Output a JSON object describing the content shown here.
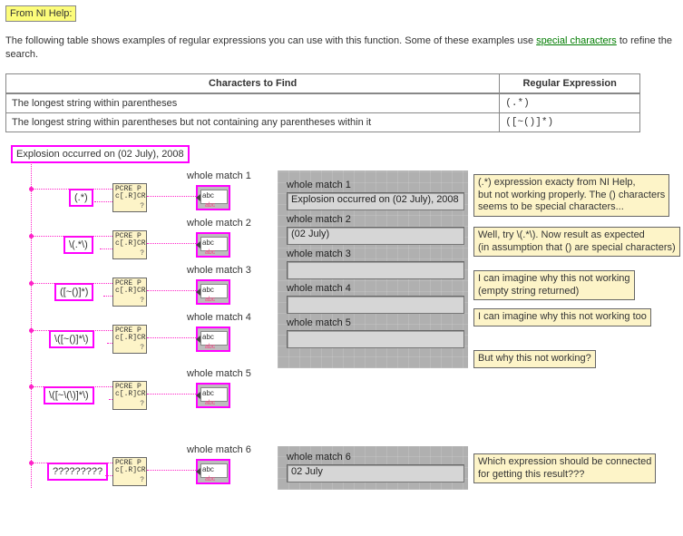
{
  "help_tag": "From NI Help:",
  "intro_prefix": "The following table shows examples of regular expressions you can use with this function. Some of these examples use ",
  "intro_link": "special characters",
  "intro_suffix": " to refine the search.",
  "table": {
    "headers": [
      "Characters to Find",
      "Regular Expression"
    ],
    "rows": [
      {
        "desc": "The longest string within parentheses",
        "regex": "(.*)"
      },
      {
        "desc": "The longest string within parentheses but not containing any parentheses within it",
        "regex": "([~()]*)"
      }
    ]
  },
  "input_string": "Explosion occurred on (02 July), 2008",
  "labels": {
    "m1": "whole match 1",
    "m2": "whole match 2",
    "m3": "whole match 3",
    "m4": "whole match 4",
    "m5": "whole match 5",
    "m6": "whole match 6"
  },
  "patterns": {
    "p1": "(.*)",
    "p2": "\\(.*\\)",
    "p3": "([~()]*)",
    "p4": "\\([~()]*\\)",
    "p5": "\\([~\\(\\)]*\\)",
    "p6": "?????????"
  },
  "pcretxt": "PCRE P\nc[.R]CR",
  "abc_text": "abc",
  "fp": {
    "m1": {
      "label": "whole match 1",
      "value": "Explosion occurred on (02 July), 2008"
    },
    "m2": {
      "label": "whole match 2",
      "value": "(02 July)"
    },
    "m3": {
      "label": "whole match 3",
      "value": ""
    },
    "m4": {
      "label": "whole match 4",
      "value": ""
    },
    "m5": {
      "label": "whole match 5",
      "value": ""
    },
    "m6": {
      "label": "whole match 6",
      "value": "02 July"
    }
  },
  "comments": {
    "c1": "(.*) expression exacty from NI Help,\nbut not working properly. The () characters\nseems to be special characters...",
    "c2": "Well, try \\(.*\\). Now result as expected\n(in assumption that () are special characters)",
    "c3": "I can imagine why this not working\n(empty string returned)",
    "c4": "I can imagine why this not working too",
    "c5": "But why this not working?",
    "c6": "Which expression should be connected\nfor getting this result???"
  }
}
